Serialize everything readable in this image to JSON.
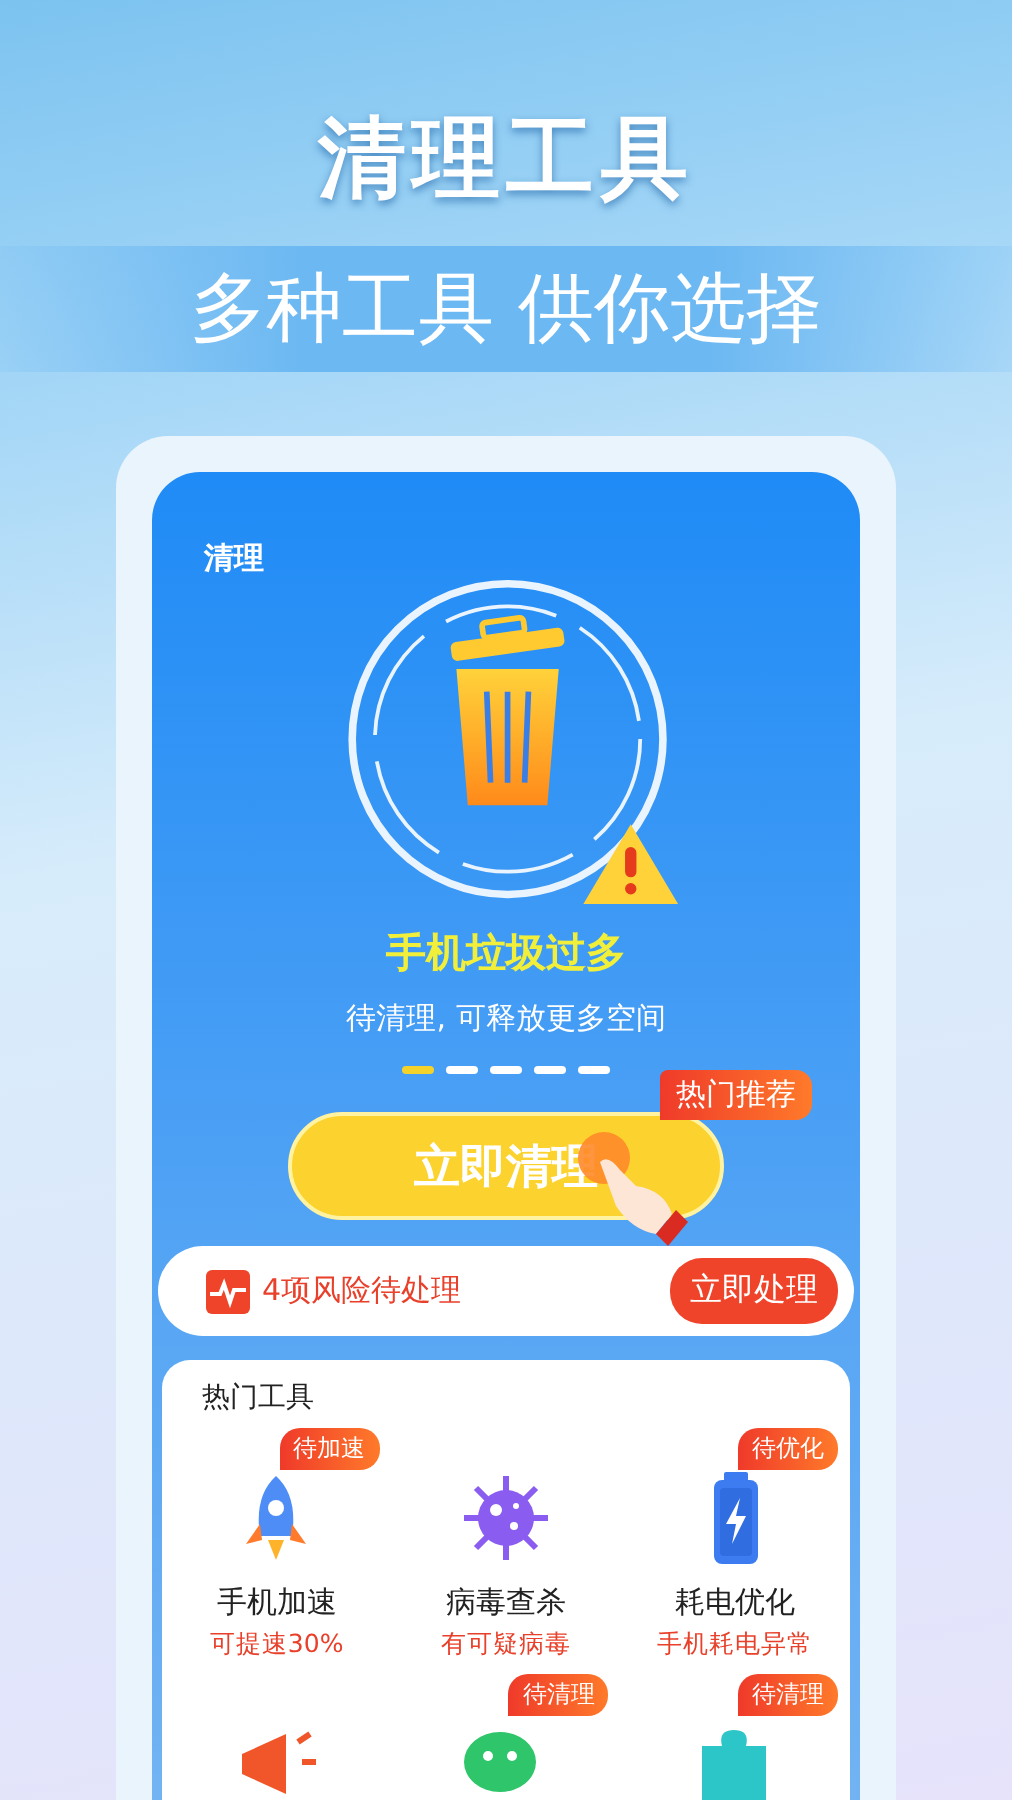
{
  "headline": "清理工具",
  "subheadline": "多种工具 供你选择",
  "clean_card": {
    "label": "清理",
    "status_title": "手机垃圾过多",
    "status_text": "待清理, 可释放更多空间",
    "dots": [
      {
        "selected": true
      },
      {
        "selected": false
      },
      {
        "selected": false
      },
      {
        "selected": false
      },
      {
        "selected": false
      }
    ],
    "button": "立即清理",
    "promo_tag": "热门推荐"
  },
  "risk_bar": {
    "text": "4项风险待处理",
    "button": "立即处理"
  },
  "hot_tools": {
    "title": "热门工具",
    "items": [
      {
        "kind": "rocket",
        "name": "手机加速",
        "note": "可提速30%",
        "badge": "待加速"
      },
      {
        "kind": "virus",
        "name": "病毒查杀",
        "note": "有可疑病毒"
      },
      {
        "kind": "battery",
        "name": "耗电优化",
        "note": "手机耗电异常",
        "badge": "待优化"
      },
      {
        "kind": "megaphone"
      },
      {
        "kind": "chat",
        "badge": "待清理"
      },
      {
        "kind": "puzzle",
        "badge": "待清理"
      }
    ]
  }
}
